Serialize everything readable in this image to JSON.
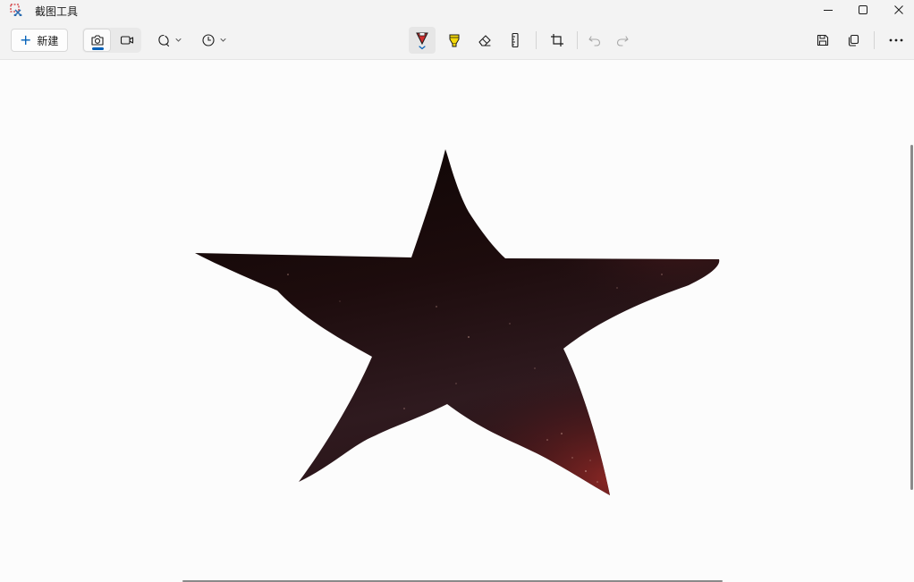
{
  "window": {
    "title": "截图工具",
    "app_icon": "snipping-tool-icon",
    "controls": [
      "minimize-icon",
      "maximize-icon",
      "close-icon"
    ]
  },
  "toolbar": {
    "new_label": "新建",
    "new_icon": "plus-icon",
    "capture_modes": [
      {
        "name": "screenshot-mode",
        "icon": "camera-icon",
        "active": true
      },
      {
        "name": "video-mode",
        "icon": "video-camera-icon",
        "active": false
      }
    ],
    "left_tools": [
      {
        "name": "snip-shape",
        "icon": "freeform-snip-icon",
        "dropdown": true
      },
      {
        "name": "delay",
        "icon": "timer-icon",
        "dropdown": true
      }
    ],
    "markup_tools": [
      {
        "name": "ballpoint-pen",
        "icon": "pen-icon",
        "selected": true
      },
      {
        "name": "highlighter",
        "icon": "highlighter-icon",
        "selected": false
      },
      {
        "name": "eraser",
        "icon": "eraser-icon",
        "selected": false
      },
      {
        "name": "ruler",
        "icon": "ruler-icon",
        "selected": false
      }
    ],
    "edit_tools": [
      {
        "name": "crop",
        "icon": "crop-icon"
      },
      {
        "name": "undo",
        "icon": "undo-icon",
        "enabled": false
      },
      {
        "name": "redo",
        "icon": "redo-icon",
        "enabled": false
      }
    ],
    "right_tools": [
      {
        "name": "save",
        "icon": "save-icon"
      },
      {
        "name": "copy",
        "icon": "copy-icon"
      },
      {
        "name": "more",
        "icon": "more-icon"
      }
    ]
  },
  "canvas": {
    "content": "star-snip-image",
    "colors": {
      "star_dark": "#120808",
      "star_mid": "#2b1416",
      "star_red": "#8a2424"
    }
  },
  "colors": {
    "accent": "#005fb8",
    "titlebar_bg": "#f3f3f3",
    "canvas_bg": "#fcfcfc",
    "pen_red": "#d12d2d",
    "highlighter_yellow": "#f5d90a"
  }
}
